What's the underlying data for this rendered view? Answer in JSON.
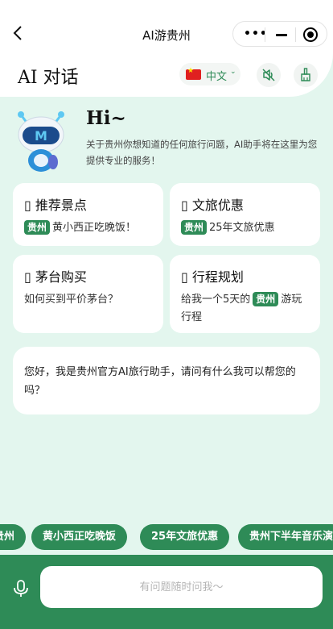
{
  "nav": {
    "title": "AI游贵州",
    "more_glyph": "•••"
  },
  "header": {
    "title": "AI 对话",
    "language": "中文",
    "caret": "⌄"
  },
  "greeting": {
    "hi": "Hi~",
    "intro": "关于贵州你想知道的任何旅行问题，AI助手将在这里为您提供专业的服务！"
  },
  "cards": [
    {
      "icon": "▯",
      "title": "推荐景点",
      "tag": "贵州",
      "text": "黄小西正吃晚饭！"
    },
    {
      "icon": "▯",
      "title": "文旅优惠",
      "tag": "贵州",
      "text": "25年文旅优惠"
    },
    {
      "icon": "▯",
      "title": "茅台购买",
      "text": "如何买到平价茅台？"
    },
    {
      "icon": "▯",
      "title": "行程规划",
      "text_before": "给我一个5天的",
      "tag": "贵州",
      "text_after": "游玩行程"
    }
  ],
  "message": "您好，我是贵州官方AI旅行助手，请问有什么我可以帮您的吗？",
  "chips": [
    "贵州",
    "黄小西正吃晚饭",
    "25年文旅优惠",
    "贵州下半年音乐演"
  ],
  "input": {
    "placeholder": "有问题随时问我～"
  },
  "colors": {
    "accent": "#2e8b57",
    "background": "#e3f6ee"
  }
}
